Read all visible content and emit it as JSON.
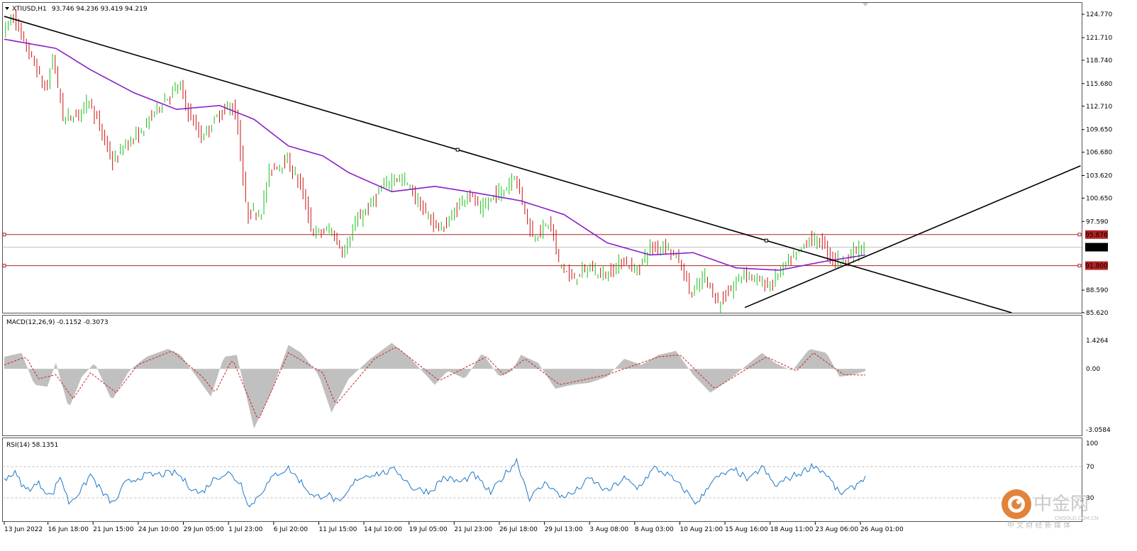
{
  "header": {
    "symbol": "XTIUSD,H1",
    "ohlc": "93.746 94.236 93.419 94.219"
  },
  "colors": {
    "bull": "#19c119",
    "bear": "#cc1111",
    "ma": "#8b1fc8",
    "trend": "#000000",
    "level": "#b22222",
    "macd_hist": "#c0c0c0",
    "macd_signal": "#d21f1f",
    "rsi": "#1e78c8"
  },
  "chart_data": [
    {
      "type": "candlestick",
      "pane": "price",
      "ylim": [
        85.62,
        125.9
      ],
      "y_ticks": [
        "124.770",
        "121.710",
        "118.740",
        "115.680",
        "112.710",
        "109.650",
        "106.680",
        "103.620",
        "100.650",
        "97.590",
        "88.590",
        "85.620"
      ],
      "y_tick_values": [
        124.77,
        121.71,
        118.74,
        115.68,
        112.71,
        109.65,
        106.68,
        103.62,
        100.65,
        97.59,
        88.59,
        85.62
      ],
      "x_ticks": [
        "13 Jun 2022",
        "16 Jun 18:00",
        "21 Jun 15:00",
        "24 Jun 10:00",
        "29 Jun 05:00",
        "1 Jul 23:00",
        "6 Jul 20:00",
        "11 Jul 15:00",
        "14 Jul 10:00",
        "19 Jul 05:00",
        "21 Jul 23:00",
        "26 Jul 18:00",
        "29 Jul 13:00",
        "3 Aug 08:00",
        "8 Aug 03:00",
        "10 Aug 21:00",
        "15 Aug 16:00",
        "18 Aug 11:00",
        "23 Aug 06:00",
        "26 Aug 01:00"
      ],
      "levels": [
        {
          "label": "95.876",
          "value": 95.876
        },
        {
          "label": "91.800",
          "value": 91.8
        }
      ],
      "current_price": {
        "label": "94.219",
        "value": 94.219
      },
      "price_path": [
        {
          "t": 0,
          "v": 122.5
        },
        {
          "t": 0.012,
          "v": 124.6
        },
        {
          "t": 0.02,
          "v": 122.0
        },
        {
          "t": 0.035,
          "v": 118.5
        },
        {
          "t": 0.05,
          "v": 114.5
        },
        {
          "t": 0.058,
          "v": 119.3
        },
        {
          "t": 0.07,
          "v": 111.0
        },
        {
          "t": 0.085,
          "v": 111.5
        },
        {
          "t": 0.1,
          "v": 113.6
        },
        {
          "t": 0.115,
          "v": 109.0
        },
        {
          "t": 0.128,
          "v": 105.2
        },
        {
          "t": 0.14,
          "v": 107.5
        },
        {
          "t": 0.16,
          "v": 109.2
        },
        {
          "t": 0.175,
          "v": 112.0
        },
        {
          "t": 0.19,
          "v": 113.8
        },
        {
          "t": 0.205,
          "v": 115.5
        },
        {
          "t": 0.215,
          "v": 112.0
        },
        {
          "t": 0.23,
          "v": 108.5
        },
        {
          "t": 0.25,
          "v": 111.5
        },
        {
          "t": 0.265,
          "v": 113.0
        },
        {
          "t": 0.272,
          "v": 110.5
        },
        {
          "t": 0.283,
          "v": 98.5
        },
        {
          "t": 0.3,
          "v": 99.0
        },
        {
          "t": 0.31,
          "v": 104.5
        },
        {
          "t": 0.33,
          "v": 105.5
        },
        {
          "t": 0.345,
          "v": 102.5
        },
        {
          "t": 0.36,
          "v": 96.0
        },
        {
          "t": 0.38,
          "v": 96.5
        },
        {
          "t": 0.395,
          "v": 93.5
        },
        {
          "t": 0.41,
          "v": 97.5
        },
        {
          "t": 0.425,
          "v": 99.5
        },
        {
          "t": 0.44,
          "v": 102.0
        },
        {
          "t": 0.455,
          "v": 103.5
        },
        {
          "t": 0.47,
          "v": 102.5
        },
        {
          "t": 0.49,
          "v": 98.5
        },
        {
          "t": 0.51,
          "v": 96.5
        },
        {
          "t": 0.525,
          "v": 99.0
        },
        {
          "t": 0.54,
          "v": 101.5
        },
        {
          "t": 0.555,
          "v": 99.0
        },
        {
          "t": 0.57,
          "v": 101.0
        },
        {
          "t": 0.585,
          "v": 102.0
        },
        {
          "t": 0.593,
          "v": 104.0
        },
        {
          "t": 0.6,
          "v": 101.5
        },
        {
          "t": 0.615,
          "v": 95.5
        },
        {
          "t": 0.635,
          "v": 97.5
        },
        {
          "t": 0.645,
          "v": 92.5
        },
        {
          "t": 0.66,
          "v": 90.0
        },
        {
          "t": 0.68,
          "v": 91.5
        },
        {
          "t": 0.7,
          "v": 90.5
        },
        {
          "t": 0.72,
          "v": 92.5
        },
        {
          "t": 0.735,
          "v": 91.0
        },
        {
          "t": 0.75,
          "v": 94.0
        },
        {
          "t": 0.77,
          "v": 94.5
        },
        {
          "t": 0.785,
          "v": 92.5
        },
        {
          "t": 0.8,
          "v": 88.0
        },
        {
          "t": 0.815,
          "v": 90.5
        },
        {
          "t": 0.83,
          "v": 86.8
        },
        {
          "t": 0.845,
          "v": 88.5
        },
        {
          "t": 0.86,
          "v": 91.0
        },
        {
          "t": 0.875,
          "v": 90.0
        },
        {
          "t": 0.89,
          "v": 89.0
        },
        {
          "t": 0.905,
          "v": 91.5
        },
        {
          "t": 0.92,
          "v": 93.0
        },
        {
          "t": 0.935,
          "v": 95.2
        },
        {
          "t": 0.95,
          "v": 95.0
        },
        {
          "t": 0.963,
          "v": 92.6
        },
        {
          "t": 0.975,
          "v": 92.5
        },
        {
          "t": 0.987,
          "v": 93.6
        },
        {
          "t": 1.0,
          "v": 94.2
        }
      ],
      "moving_average": [
        {
          "t": 0,
          "v": 121.5
        },
        {
          "t": 0.06,
          "v": 120.3
        },
        {
          "t": 0.1,
          "v": 117.5
        },
        {
          "t": 0.15,
          "v": 114.5
        },
        {
          "t": 0.2,
          "v": 112.3
        },
        {
          "t": 0.25,
          "v": 112.8
        },
        {
          "t": 0.29,
          "v": 111.0
        },
        {
          "t": 0.33,
          "v": 107.5
        },
        {
          "t": 0.37,
          "v": 106.2
        },
        {
          "t": 0.4,
          "v": 104.0
        },
        {
          "t": 0.45,
          "v": 101.5
        },
        {
          "t": 0.5,
          "v": 102.2
        },
        {
          "t": 0.55,
          "v": 101.3
        },
        {
          "t": 0.6,
          "v": 100.3
        },
        {
          "t": 0.65,
          "v": 98.5
        },
        {
          "t": 0.7,
          "v": 94.8
        },
        {
          "t": 0.75,
          "v": 93.2
        },
        {
          "t": 0.8,
          "v": 93.5
        },
        {
          "t": 0.85,
          "v": 91.5
        },
        {
          "t": 0.9,
          "v": 91.2
        },
        {
          "t": 0.95,
          "v": 92.3
        },
        {
          "t": 1.0,
          "v": 93.2
        }
      ],
      "trendlines": [
        {
          "name": "downtrend",
          "t1": 0.0,
          "v1": 124.5,
          "t2": 1.17,
          "v2": 85.62
        },
        {
          "name": "uptrend",
          "t1": 0.86,
          "v1": 86.3,
          "t2": 1.25,
          "v2": 104.9
        }
      ]
    },
    {
      "type": "area",
      "pane": "macd",
      "title": "MACD(12,26,9) -0.1152 -0.3073",
      "ylim": [
        -3.0584,
        1.4264
      ],
      "y_ticks": [
        "1.4264",
        "0.00",
        "-3.0584"
      ],
      "y_tick_values": [
        1.4264,
        0.0,
        -3.0584
      ],
      "histogram": [
        {
          "t": 0,
          "v": 0.6
        },
        {
          "t": 0.02,
          "v": 0.8
        },
        {
          "t": 0.035,
          "v": -0.8
        },
        {
          "t": 0.05,
          "v": -0.9
        },
        {
          "t": 0.06,
          "v": 0.3
        },
        {
          "t": 0.075,
          "v": -2.0
        },
        {
          "t": 0.09,
          "v": -0.4
        },
        {
          "t": 0.105,
          "v": 0.3
        },
        {
          "t": 0.125,
          "v": -1.6
        },
        {
          "t": 0.145,
          "v": -0.1
        },
        {
          "t": 0.165,
          "v": 0.6
        },
        {
          "t": 0.19,
          "v": 1.0
        },
        {
          "t": 0.205,
          "v": 0.7
        },
        {
          "t": 0.225,
          "v": -0.5
        },
        {
          "t": 0.24,
          "v": -1.4
        },
        {
          "t": 0.255,
          "v": 0.6
        },
        {
          "t": 0.27,
          "v": 0.7
        },
        {
          "t": 0.29,
          "v": -3.0
        },
        {
          "t": 0.31,
          "v": -1.2
        },
        {
          "t": 0.33,
          "v": 1.2
        },
        {
          "t": 0.345,
          "v": 0.8
        },
        {
          "t": 0.365,
          "v": -0.3
        },
        {
          "t": 0.38,
          "v": -2.2
        },
        {
          "t": 0.4,
          "v": -0.5
        },
        {
          "t": 0.425,
          "v": 0.5
        },
        {
          "t": 0.45,
          "v": 1.3
        },
        {
          "t": 0.47,
          "v": 0.6
        },
        {
          "t": 0.5,
          "v": -0.8
        },
        {
          "t": 0.515,
          "v": -0.1
        },
        {
          "t": 0.535,
          "v": -0.5
        },
        {
          "t": 0.555,
          "v": 0.8
        },
        {
          "t": 0.575,
          "v": -0.4
        },
        {
          "t": 0.59,
          "v": -0.1
        },
        {
          "t": 0.6,
          "v": 0.7
        },
        {
          "t": 0.62,
          "v": 0.3
        },
        {
          "t": 0.64,
          "v": -1.0
        },
        {
          "t": 0.66,
          "v": -0.8
        },
        {
          "t": 0.68,
          "v": -0.7
        },
        {
          "t": 0.7,
          "v": -0.4
        },
        {
          "t": 0.72,
          "v": 0.5
        },
        {
          "t": 0.74,
          "v": 0.2
        },
        {
          "t": 0.76,
          "v": 0.7
        },
        {
          "t": 0.78,
          "v": 0.9
        },
        {
          "t": 0.8,
          "v": -0.3
        },
        {
          "t": 0.82,
          "v": -1.2
        },
        {
          "t": 0.84,
          "v": -0.6
        },
        {
          "t": 0.86,
          "v": 0.1
        },
        {
          "t": 0.88,
          "v": 0.8
        },
        {
          "t": 0.895,
          "v": 0.3
        },
        {
          "t": 0.915,
          "v": -0.1
        },
        {
          "t": 0.935,
          "v": 1.0
        },
        {
          "t": 0.955,
          "v": 0.8
        },
        {
          "t": 0.97,
          "v": -0.4
        },
        {
          "t": 0.985,
          "v": -0.3
        },
        {
          "t": 1.0,
          "v": -0.12
        }
      ],
      "signal": [
        {
          "t": 0,
          "v": 0.2
        },
        {
          "t": 0.025,
          "v": 0.6
        },
        {
          "t": 0.04,
          "v": -0.5
        },
        {
          "t": 0.06,
          "v": -0.3
        },
        {
          "t": 0.08,
          "v": -1.5
        },
        {
          "t": 0.1,
          "v": -0.2
        },
        {
          "t": 0.13,
          "v": -1.2
        },
        {
          "t": 0.155,
          "v": 0.2
        },
        {
          "t": 0.195,
          "v": 0.9
        },
        {
          "t": 0.23,
          "v": -0.4
        },
        {
          "t": 0.245,
          "v": -1.2
        },
        {
          "t": 0.265,
          "v": 0.5
        },
        {
          "t": 0.295,
          "v": -2.6
        },
        {
          "t": 0.33,
          "v": 0.8
        },
        {
          "t": 0.37,
          "v": -0.2
        },
        {
          "t": 0.385,
          "v": -1.8
        },
        {
          "t": 0.43,
          "v": 0.5
        },
        {
          "t": 0.455,
          "v": 1.1
        },
        {
          "t": 0.505,
          "v": -0.6
        },
        {
          "t": 0.56,
          "v": 0.6
        },
        {
          "t": 0.58,
          "v": -0.3
        },
        {
          "t": 0.605,
          "v": 0.5
        },
        {
          "t": 0.645,
          "v": -0.8
        },
        {
          "t": 0.7,
          "v": -0.3
        },
        {
          "t": 0.76,
          "v": 0.6
        },
        {
          "t": 0.785,
          "v": 0.7
        },
        {
          "t": 0.825,
          "v": -1.0
        },
        {
          "t": 0.885,
          "v": 0.6
        },
        {
          "t": 0.92,
          "v": -0.1
        },
        {
          "t": 0.94,
          "v": 0.8
        },
        {
          "t": 0.975,
          "v": -0.3
        },
        {
          "t": 1.0,
          "v": -0.31
        }
      ]
    },
    {
      "type": "line",
      "pane": "rsi",
      "title": "RSI(14) 58.1351",
      "ylim": [
        0,
        100
      ],
      "y_ticks": [
        "100",
        "70",
        "30"
      ],
      "y_tick_values": [
        100,
        70,
        30
      ],
      "values": [
        {
          "t": 0,
          "v": 55
        },
        {
          "t": 0.012,
          "v": 62
        },
        {
          "t": 0.025,
          "v": 40
        },
        {
          "t": 0.04,
          "v": 48
        },
        {
          "t": 0.055,
          "v": 32
        },
        {
          "t": 0.065,
          "v": 58
        },
        {
          "t": 0.075,
          "v": 24
        },
        {
          "t": 0.09,
          "v": 40
        },
        {
          "t": 0.1,
          "v": 60
        },
        {
          "t": 0.115,
          "v": 35
        },
        {
          "t": 0.127,
          "v": 22
        },
        {
          "t": 0.14,
          "v": 48
        },
        {
          "t": 0.16,
          "v": 58
        },
        {
          "t": 0.18,
          "v": 60
        },
        {
          "t": 0.2,
          "v": 62
        },
        {
          "t": 0.215,
          "v": 45
        },
        {
          "t": 0.228,
          "v": 35
        },
        {
          "t": 0.245,
          "v": 56
        },
        {
          "t": 0.26,
          "v": 62
        },
        {
          "t": 0.275,
          "v": 48
        },
        {
          "t": 0.285,
          "v": 18
        },
        {
          "t": 0.3,
          "v": 40
        },
        {
          "t": 0.315,
          "v": 60
        },
        {
          "t": 0.33,
          "v": 68
        },
        {
          "t": 0.345,
          "v": 50
        },
        {
          "t": 0.36,
          "v": 30
        },
        {
          "t": 0.375,
          "v": 35
        },
        {
          "t": 0.39,
          "v": 22
        },
        {
          "t": 0.41,
          "v": 55
        },
        {
          "t": 0.425,
          "v": 60
        },
        {
          "t": 0.44,
          "v": 62
        },
        {
          "t": 0.455,
          "v": 66
        },
        {
          "t": 0.475,
          "v": 42
        },
        {
          "t": 0.495,
          "v": 38
        },
        {
          "t": 0.51,
          "v": 56
        },
        {
          "t": 0.53,
          "v": 50
        },
        {
          "t": 0.545,
          "v": 60
        },
        {
          "t": 0.565,
          "v": 36
        },
        {
          "t": 0.58,
          "v": 58
        },
        {
          "t": 0.595,
          "v": 78
        },
        {
          "t": 0.61,
          "v": 30
        },
        {
          "t": 0.63,
          "v": 50
        },
        {
          "t": 0.645,
          "v": 32
        },
        {
          "t": 0.66,
          "v": 35
        },
        {
          "t": 0.68,
          "v": 55
        },
        {
          "t": 0.7,
          "v": 38
        },
        {
          "t": 0.72,
          "v": 55
        },
        {
          "t": 0.735,
          "v": 42
        },
        {
          "t": 0.755,
          "v": 68
        },
        {
          "t": 0.77,
          "v": 60
        },
        {
          "t": 0.79,
          "v": 40
        },
        {
          "t": 0.805,
          "v": 22
        },
        {
          "t": 0.82,
          "v": 50
        },
        {
          "t": 0.835,
          "v": 60
        },
        {
          "t": 0.85,
          "v": 65
        },
        {
          "t": 0.865,
          "v": 52
        },
        {
          "t": 0.88,
          "v": 70
        },
        {
          "t": 0.895,
          "v": 45
        },
        {
          "t": 0.91,
          "v": 55
        },
        {
          "t": 0.925,
          "v": 62
        },
        {
          "t": 0.94,
          "v": 72
        },
        {
          "t": 0.955,
          "v": 60
        },
        {
          "t": 0.97,
          "v": 35
        },
        {
          "t": 0.985,
          "v": 42
        },
        {
          "t": 1.0,
          "v": 58
        }
      ]
    }
  ],
  "watermark": {
    "chinese_name": "中金网",
    "subtitle": "中 文 财 经 新 媒 体",
    "site": "CNGOLD.COM.CN"
  }
}
